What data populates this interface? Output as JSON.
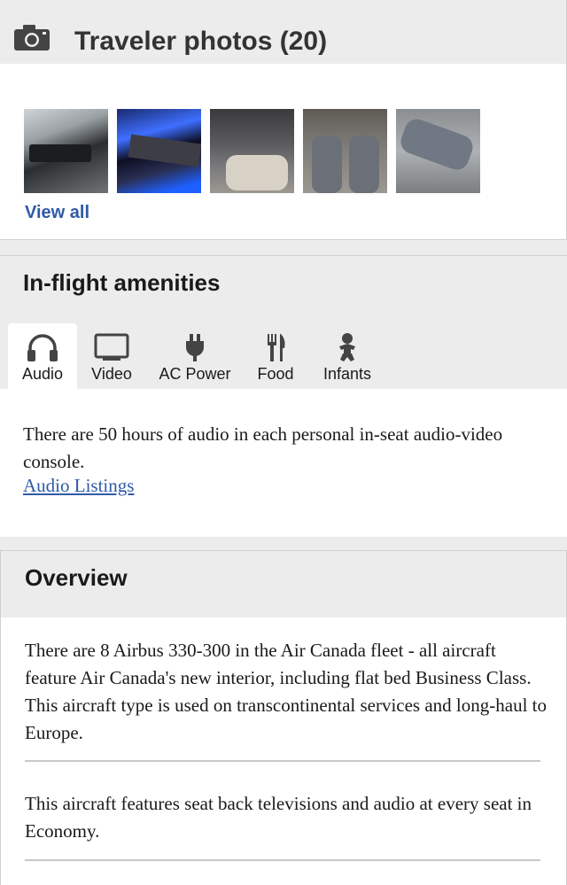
{
  "photos": {
    "title": "Traveler photos (20)",
    "view_all": "View all",
    "icon": "camera-icon"
  },
  "amenities": {
    "title": "In-flight amenities",
    "tabs": [
      {
        "label": "Audio",
        "icon": "headphones-icon",
        "active": true
      },
      {
        "label": "Video",
        "icon": "monitor-icon",
        "active": false
      },
      {
        "label": "AC Power",
        "icon": "power-plug-icon",
        "active": false
      },
      {
        "label": "Food",
        "icon": "fork-knife-icon",
        "active": false
      },
      {
        "label": "Infants",
        "icon": "baby-icon",
        "active": false
      }
    ],
    "text": "There are 50 hours of audio in each personal in-seat audio-video console.",
    "link": "Audio Listings"
  },
  "overview": {
    "title": "Overview",
    "paragraphs": [
      "There are 8 Airbus 330-300 in the Air Canada fleet - all aircraft feature Air Canada's new interior, including flat bed Business Class. This aircraft type is used on transcontinental services and long-haul to Europe.",
      "This aircraft features seat back televisions and audio at every seat in Economy."
    ]
  },
  "colors": {
    "link": "#2f5aa6",
    "panel_header": "#ececec"
  }
}
